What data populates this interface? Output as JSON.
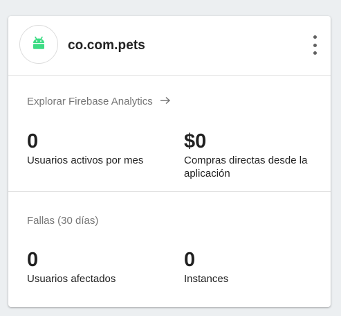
{
  "app": {
    "name": "co.com.pets",
    "icon": "android-icon",
    "icon_color": "#3ddc84",
    "menu_icon": "more-vert-icon"
  },
  "analytics": {
    "link_label": "Explorar Firebase Analytics",
    "arrow": "→",
    "metrics": [
      {
        "value": "0",
        "label": "Usuarios activos por mes"
      },
      {
        "value": "$0",
        "label": "Compras directas desde la aplicación"
      }
    ]
  },
  "crashes": {
    "section_label": "Fallas (30 días)",
    "metrics": [
      {
        "value": "0",
        "label": "Usuarios afectados"
      },
      {
        "value": "0",
        "label": "Instances"
      }
    ]
  }
}
